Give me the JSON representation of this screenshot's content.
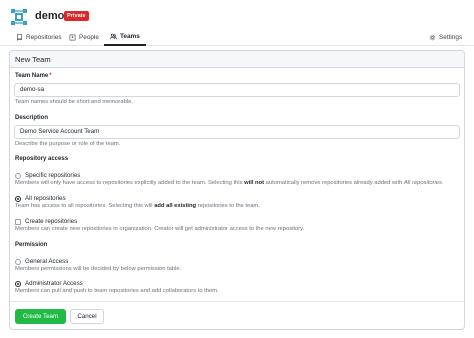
{
  "org": {
    "name": "demo",
    "badge": "Private"
  },
  "tabs": {
    "repositories": "Repositories",
    "people": "People",
    "teams": "Teams",
    "settings": "Settings"
  },
  "card": {
    "title": "New Team"
  },
  "team_name": {
    "label": "Team Name",
    "required_mark": "*",
    "value": "demo-sa",
    "help": "Team names should be short and memorable."
  },
  "description": {
    "label": "Description",
    "value": "Demo Service Account Team",
    "help": "Describe the purpose or role of the team."
  },
  "repo_access": {
    "label": "Repository access",
    "specific": {
      "label": "Specific repositories",
      "help_1": "Members will only have access to repositories explicitly added to the team. Selecting this ",
      "help_bold": "will not",
      "help_2": " automatically remove repositories already added with ",
      "help_italic": "All repositories",
      "help_3": "."
    },
    "all": {
      "label": "All repositories",
      "help_1": "Team has access to all repositories. Selecting this will ",
      "help_bold": "add all existing",
      "help_2": " repositories to the team."
    },
    "selected": "all"
  },
  "create_repo": {
    "label": "Create repositories",
    "help": "Members can create new repositories in organization. Creator will get administrator access to the new repository."
  },
  "permission": {
    "label": "Permission",
    "general": {
      "label": "General Access",
      "help": "Members permissions will be decided by below permission table."
    },
    "admin": {
      "label": "Administrator Access",
      "help": "Members can pull and push to team repositories and add collaborators to them."
    },
    "selected": "admin"
  },
  "buttons": {
    "create": "Create Team",
    "cancel": "Cancel"
  },
  "colors": {
    "primary": "#21ba45",
    "badge": "#db2828",
    "accent": "#3aa0c8"
  }
}
